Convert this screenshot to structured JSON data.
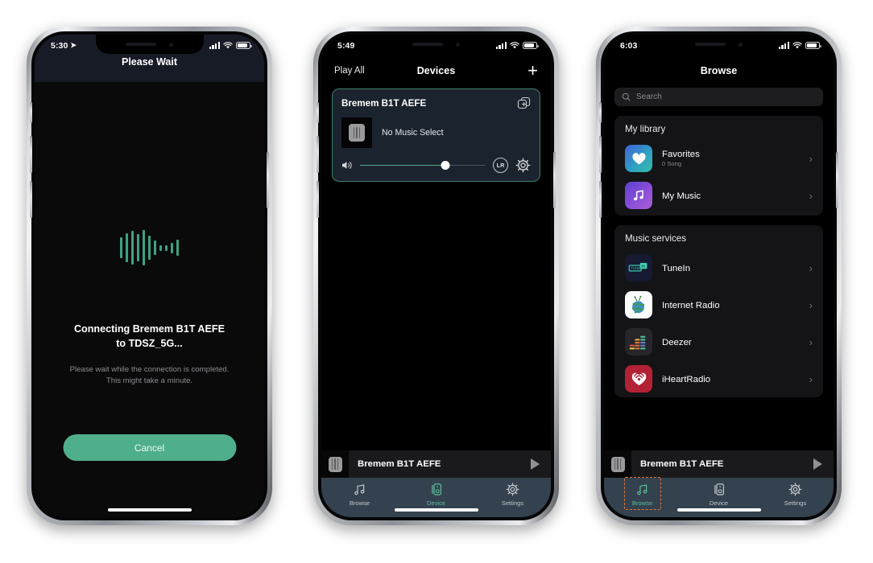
{
  "colors": {
    "accent_teal": "#4faf8b",
    "tab_bar_bg": "#33424e",
    "card_border": "#3e7e6c",
    "card_bg": "#1b232e",
    "highlight_orange": "#e2763a",
    "screen_black": "#0a0a0b"
  },
  "phone1": {
    "status": {
      "time": "5:30",
      "location_icon": "location-arrow-icon",
      "signal_icon": "cellular-signal-icon",
      "wifi_icon": "wifi-icon",
      "battery_icon": "battery-icon"
    },
    "navbar": {
      "title": "Please Wait"
    },
    "waveform_icon": "audio-waveform-icon",
    "connecting_line1": "Connecting Bremem B1T AEFE",
    "connecting_line2": "to TDSZ_5G...",
    "hint_line1": "Please wait while the connection is completed.",
    "hint_line2": "This might take a minute.",
    "cancel_label": "Cancel"
  },
  "phone2": {
    "status": {
      "time": "5:49",
      "signal_icon": "cellular-signal-icon",
      "wifi_icon": "wifi-icon",
      "battery_icon": "battery-icon"
    },
    "navbar": {
      "left_label": "Play All",
      "title": "Devices",
      "add_icon": "plus-icon"
    },
    "device_card": {
      "name": "Bremem B1T AEFE",
      "group_icon": "add-to-group-icon",
      "art_icon": "speaker-icon",
      "status_text": "No Music Select",
      "volume_icon": "volume-icon",
      "volume_percent": 68,
      "lr_label": "LR",
      "settings_icon": "gear-icon"
    },
    "now_playing": {
      "art_icon": "speaker-icon",
      "title": "Bremem B1T AEFE",
      "play_icon": "play-icon"
    },
    "tabs": [
      {
        "label": "Browse",
        "icon": "music-note-icon",
        "active": false
      },
      {
        "label": "Device",
        "icon": "speaker-icon",
        "active": true
      },
      {
        "label": "Settings",
        "icon": "gear-icon",
        "active": false
      }
    ]
  },
  "phone3": {
    "status": {
      "time": "6:03",
      "signal_icon": "cellular-signal-icon",
      "wifi_icon": "wifi-icon",
      "battery_icon": "battery-icon"
    },
    "navbar": {
      "title": "Browse"
    },
    "search": {
      "icon": "search-icon",
      "placeholder": "Search",
      "value": ""
    },
    "library": {
      "title": "My library",
      "items": [
        {
          "name": "Favorites",
          "sub": "0 Song",
          "icon": "heart-icon",
          "chevron": "chevron-right-icon"
        },
        {
          "name": "My Music",
          "sub": "",
          "icon": "music-note-icon",
          "chevron": "chevron-right-icon"
        }
      ]
    },
    "services": {
      "title": "Music services",
      "items": [
        {
          "name": "TuneIn",
          "icon": "tunein-logo-icon",
          "chevron": "chevron-right-icon"
        },
        {
          "name": "Internet Radio",
          "icon": "globe-antenna-icon",
          "chevron": "chevron-right-icon"
        },
        {
          "name": "Deezer",
          "icon": "deezer-logo-icon",
          "chevron": "chevron-right-icon"
        },
        {
          "name": "iHeartRadio",
          "icon": "iheartradio-logo-icon",
          "chevron": "chevron-right-icon"
        }
      ]
    },
    "now_playing": {
      "art_icon": "speaker-icon",
      "title": "Bremem B1T AEFE",
      "play_icon": "play-icon"
    },
    "tabs": [
      {
        "label": "Browse",
        "icon": "music-note-icon",
        "active": true
      },
      {
        "label": "Device",
        "icon": "speaker-icon",
        "active": false
      },
      {
        "label": "Settings",
        "icon": "gear-icon",
        "active": false
      }
    ]
  }
}
